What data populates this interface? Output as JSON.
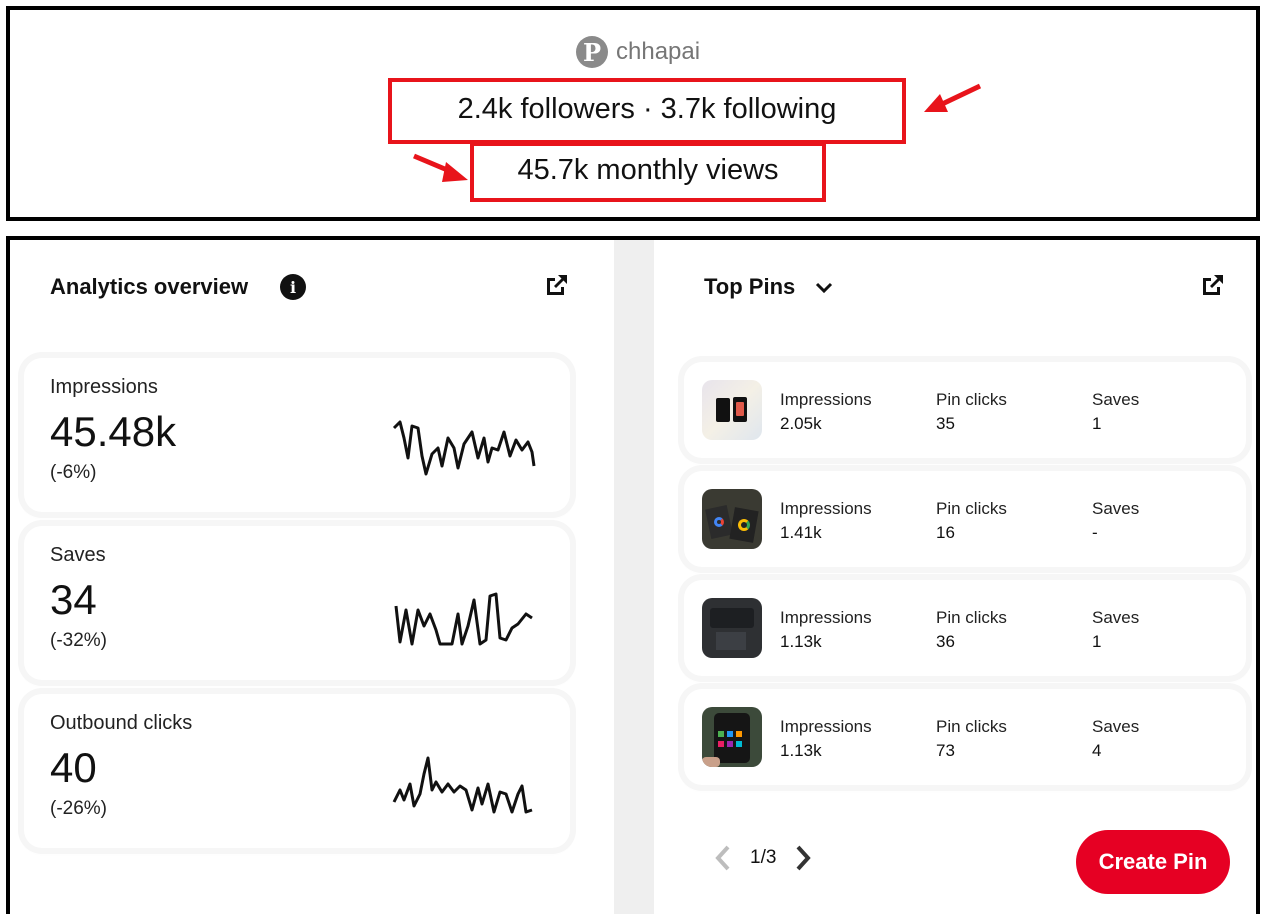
{
  "profile": {
    "username": "chhapai",
    "followers_line": "2.4k followers · 3.7k following",
    "monthly_views": "45.7k monthly views",
    "logo_icon": "pinterest-logo-icon"
  },
  "analytics": {
    "title": "Analytics overview",
    "info_icon": "info-icon",
    "external_icon": "external-link-icon",
    "metrics": [
      {
        "label": "Impressions",
        "value": "45.48k",
        "change": "(-6%)"
      },
      {
        "label": "Saves",
        "value": "34",
        "change": "(-32%)"
      },
      {
        "label": "Outbound clicks",
        "value": "40",
        "change": "(-26%)"
      }
    ]
  },
  "top_pins": {
    "title": "Top Pins",
    "dropdown_icon": "chevron-down-icon",
    "external_icon": "external-link-icon",
    "pins": [
      {
        "impressions_label": "Impressions",
        "impressions": "2.05k",
        "clicks_label": "Pin clicks",
        "clicks": "35",
        "saves_label": "Saves",
        "saves": "1"
      },
      {
        "impressions_label": "Impressions",
        "impressions": "1.41k",
        "clicks_label": "Pin clicks",
        "clicks": "16",
        "saves_label": "Saves",
        "saves": "-"
      },
      {
        "impressions_label": "Impressions",
        "impressions": "1.13k",
        "clicks_label": "Pin clicks",
        "clicks": "36",
        "saves_label": "Saves",
        "saves": "1"
      },
      {
        "impressions_label": "Impressions",
        "impressions": "1.13k",
        "clicks_label": "Pin clicks",
        "clicks": "73",
        "saves_label": "Saves",
        "saves": "4"
      }
    ],
    "pager": {
      "text": "1/3"
    },
    "create_button": "Create Pin"
  },
  "colors": {
    "accent": "#e60023",
    "annotation_red": "#e8141b"
  }
}
